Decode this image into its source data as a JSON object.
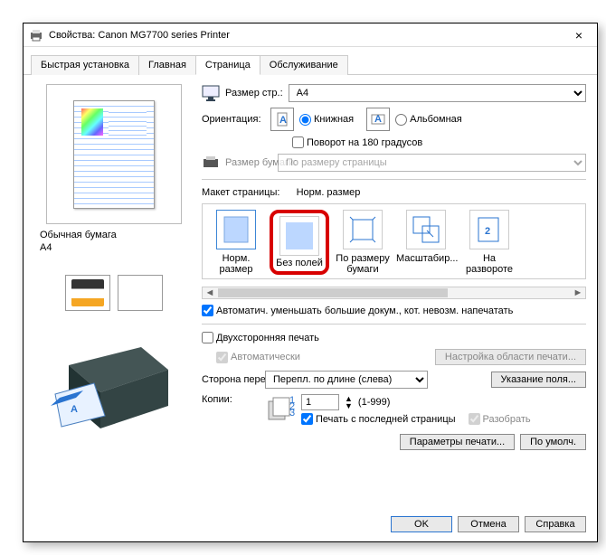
{
  "window": {
    "title": "Свойства: Canon MG7700 series Printer"
  },
  "tabs": [
    "Быстрая установка",
    "Главная",
    "Страница",
    "Обслуживание"
  ],
  "active_tab": 2,
  "preview": {
    "paper_type": "Обычная бумага",
    "paper_size": "A4"
  },
  "page_size": {
    "label": "Размер стр.:",
    "value": "A4"
  },
  "orientation": {
    "label": "Ориентация:",
    "options": [
      "Книжная",
      "Альбомная"
    ],
    "selected": 0,
    "rotate": "Поворот на 180 градусов"
  },
  "paper_sz": {
    "label": "Размер бумаги:",
    "value": "По размеру страницы"
  },
  "layout": {
    "label": "Макет страницы:",
    "current": "Норм. размер",
    "items": [
      {
        "label": "Норм. размер",
        "icon": "normal"
      },
      {
        "label": "Без полей",
        "icon": "borderless",
        "highlight": true
      },
      {
        "label": "По размеру бумаги",
        "icon": "fit"
      },
      {
        "label": "Масштабир...",
        "icon": "scale"
      },
      {
        "label": "На развороте",
        "icon": "nup"
      }
    ]
  },
  "auto_reduce": {
    "label": "Автоматич. уменьшать большие докум., кот. невозм. напечатать",
    "checked": true
  },
  "duplex": {
    "label": "Двухсторонняя печать",
    "checked": false,
    "auto": "Автоматически",
    "auto_checked": true,
    "area_btn": "Настройка области печати..."
  },
  "binding": {
    "label": "Сторона переплета:",
    "value": "Перепл. по длине (слева)",
    "margin_btn": "Указание поля..."
  },
  "copies": {
    "label": "Копии:",
    "value": "1",
    "range": "(1-999)",
    "last": "Печать с последней страницы",
    "last_checked": true,
    "collate": "Разобрать",
    "collate_checked": true
  },
  "param_btns": {
    "print": "Параметры печати...",
    "defaults": "По умолч."
  },
  "buttons": {
    "ok": "OK",
    "cancel": "Отмена",
    "help": "Справка"
  }
}
